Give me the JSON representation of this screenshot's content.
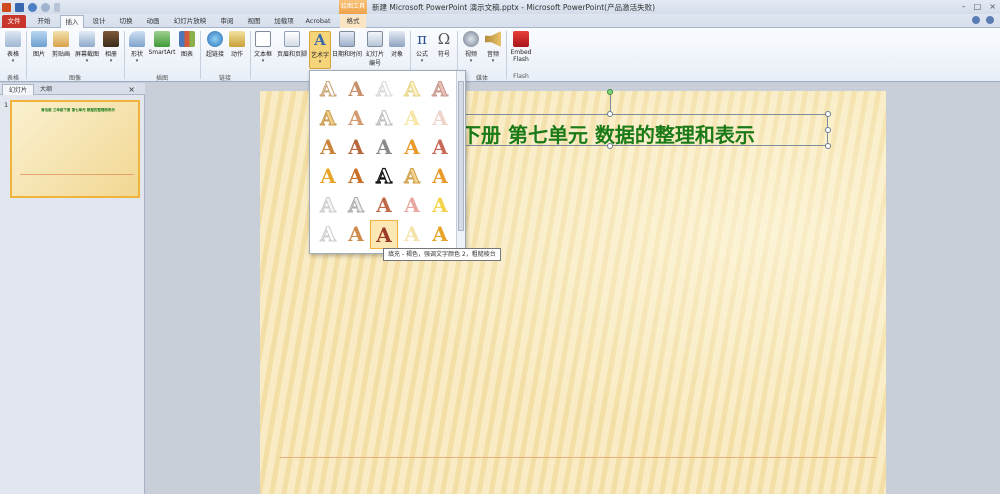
{
  "titlebar": {
    "title": "新建 Microsoft PowerPoint 演示文稿.pptx  -  Microsoft PowerPoint(产品激活失败)",
    "context_tool": "绘图工具"
  },
  "tabs": {
    "file": "文件",
    "home": "开始",
    "insert": "插入",
    "design": "设计",
    "transitions": "切换",
    "animations": "动画",
    "slideshow": "幻灯片放映",
    "review": "审阅",
    "view": "视图",
    "addins": "加载项",
    "acrobat": "Acrobat",
    "format": "格式"
  },
  "ribbon": {
    "table": "表格",
    "picture": "图片",
    "clipart": "剪贴画",
    "screenshot": "屏幕截图",
    "album": "相册",
    "shapes": "形状",
    "smartart": "SmartArt",
    "chart": "图表",
    "hyperlink": "超链接",
    "action": "动作",
    "textbox": "文本框",
    "headerfooter": "页眉和页脚",
    "wordart": "艺术字",
    "datetime": "日期和时间",
    "slidenumber_line1": "幻灯片",
    "slidenumber_line2": "编号",
    "object": "对象",
    "equation": "公式",
    "symbol": "符号",
    "video": "视频",
    "audio": "音频",
    "flash_line1": "Embed",
    "flash_line2": "Flash",
    "groups": {
      "tables": "表格",
      "images": "图像",
      "illustrations": "插图",
      "links": "链接",
      "media": "媒体",
      "flash": "Flash"
    }
  },
  "leftpanel": {
    "tab_slides": "幻灯片",
    "tab_outline": "大纲",
    "slide_number": "1",
    "thumb_title": "青岛版 三年级下册 第七单元 数据的整理和表示"
  },
  "slide": {
    "title": "三年级下册  第七单元  数据的整理和表示"
  },
  "gallery": {
    "glyph": "A",
    "tooltip": "填充 - 褐色，强调文字颜色 2，粗糙棱台"
  },
  "colors": {
    "accent": "#1a7a17",
    "file_tab": "#c8362b",
    "selection": "#f0b33b"
  }
}
